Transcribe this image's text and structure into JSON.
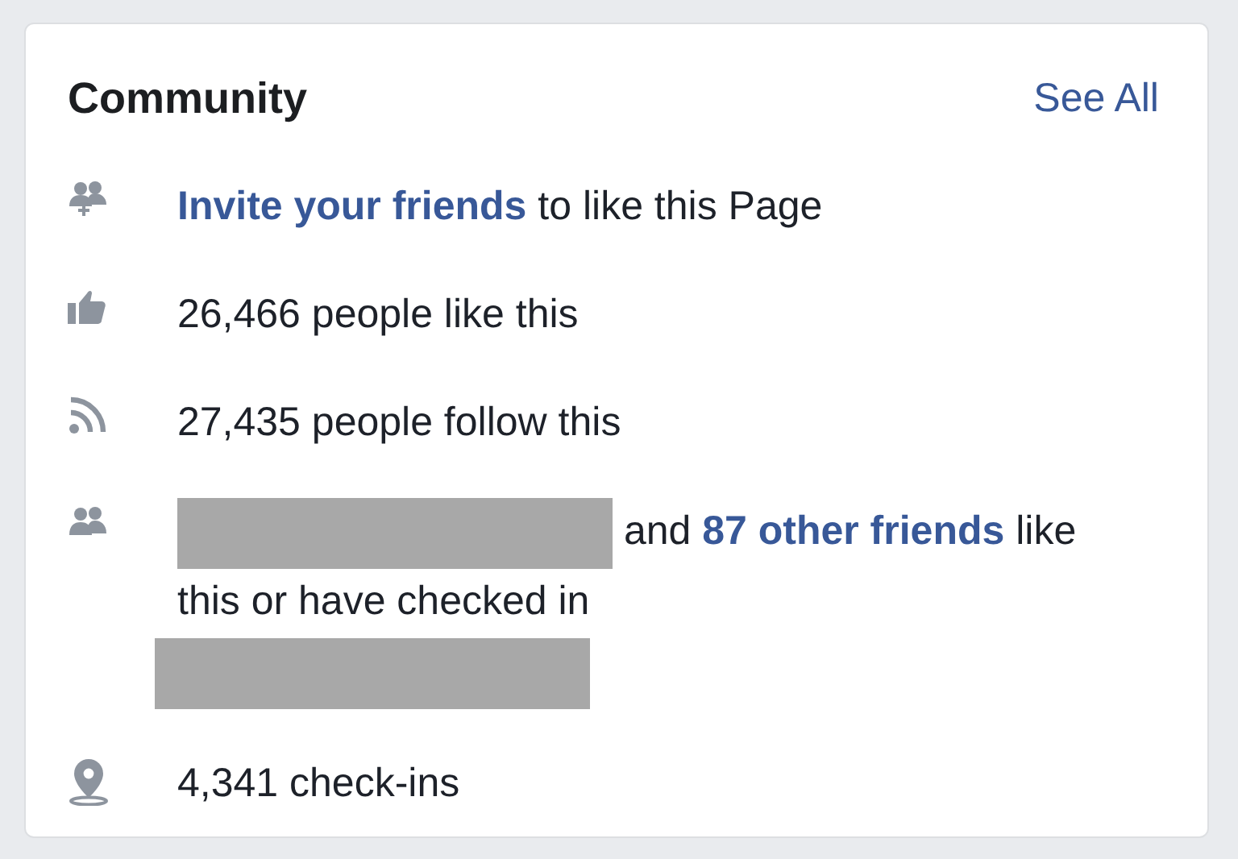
{
  "card": {
    "title": "Community",
    "see_all": "See All"
  },
  "rows": [
    {
      "kind": "invite",
      "parts": [
        {
          "kind": "link",
          "text": "Invite your friends"
        },
        {
          "kind": "text",
          "text": " to like this Page"
        }
      ]
    },
    {
      "kind": "like",
      "parts": [
        {
          "kind": "text",
          "text": "26,466 people like this"
        }
      ]
    },
    {
      "kind": "follow",
      "parts": [
        {
          "kind": "text",
          "text": "27,435 people follow this"
        }
      ]
    },
    {
      "kind": "friends",
      "parts": [
        {
          "kind": "redacted"
        },
        {
          "kind": "text",
          "text": " and "
        },
        {
          "kind": "link",
          "text": "87 other friends"
        },
        {
          "kind": "text",
          "text": " like this or have checked in "
        },
        {
          "kind": "redacted"
        }
      ]
    },
    {
      "kind": "checkin",
      "parts": [
        {
          "kind": "text",
          "text": "4,341 check-ins"
        }
      ]
    }
  ]
}
